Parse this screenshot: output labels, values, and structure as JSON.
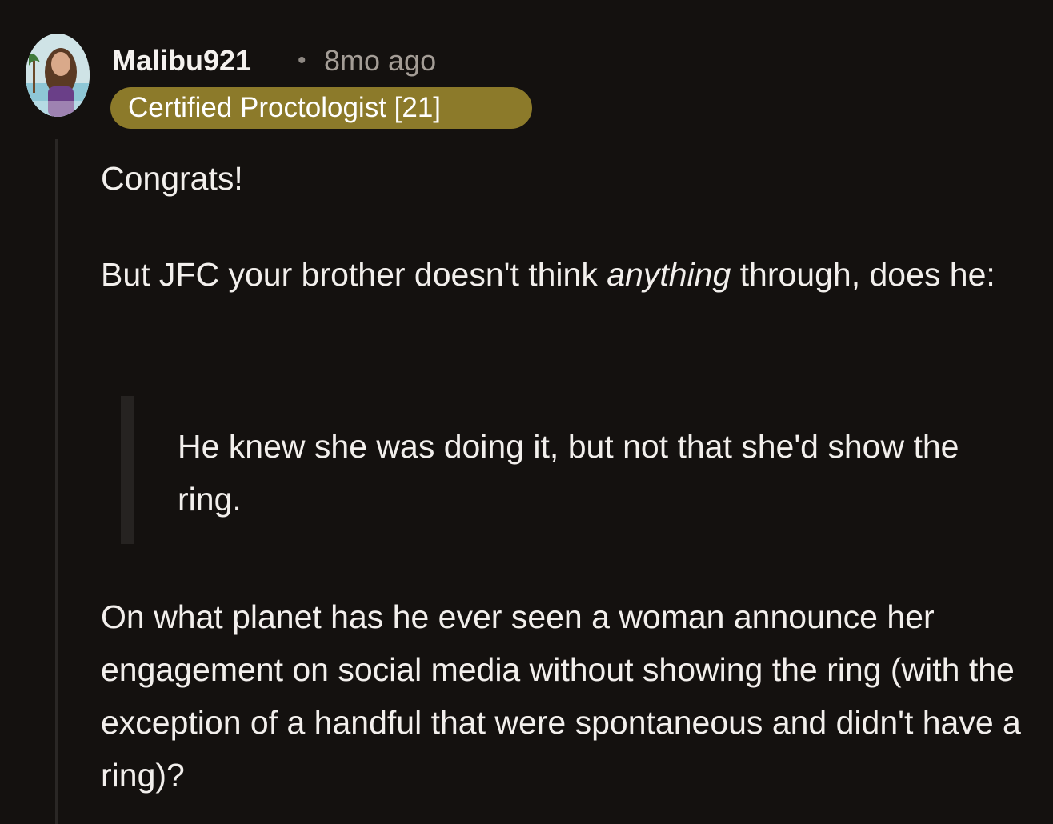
{
  "comment": {
    "author": "Malibu921",
    "separator": "•",
    "time_ago": "8mo ago",
    "flair": "Certified Proctologist [21]",
    "paragraph_1": "Congrats!",
    "paragraph_2_before": "But JFC your brother doesn't think ",
    "paragraph_2_emphasis": "anything",
    "paragraph_2_after": " through, does he:",
    "quote": "He knew she was doing it, but not that she'd show the ring.",
    "paragraph_3": "On what planet has he ever seen a woman announce her engagement on social media without showing the ring (with the exception of a handful that were spontaneous and didn't have a ring)?"
  },
  "colors": {
    "background": "#14110f",
    "flair_background": "#8c7a2a",
    "text": "#f2efec",
    "muted_text": "#a49d96"
  },
  "icons": {
    "avatar": "user-avatar-image"
  }
}
